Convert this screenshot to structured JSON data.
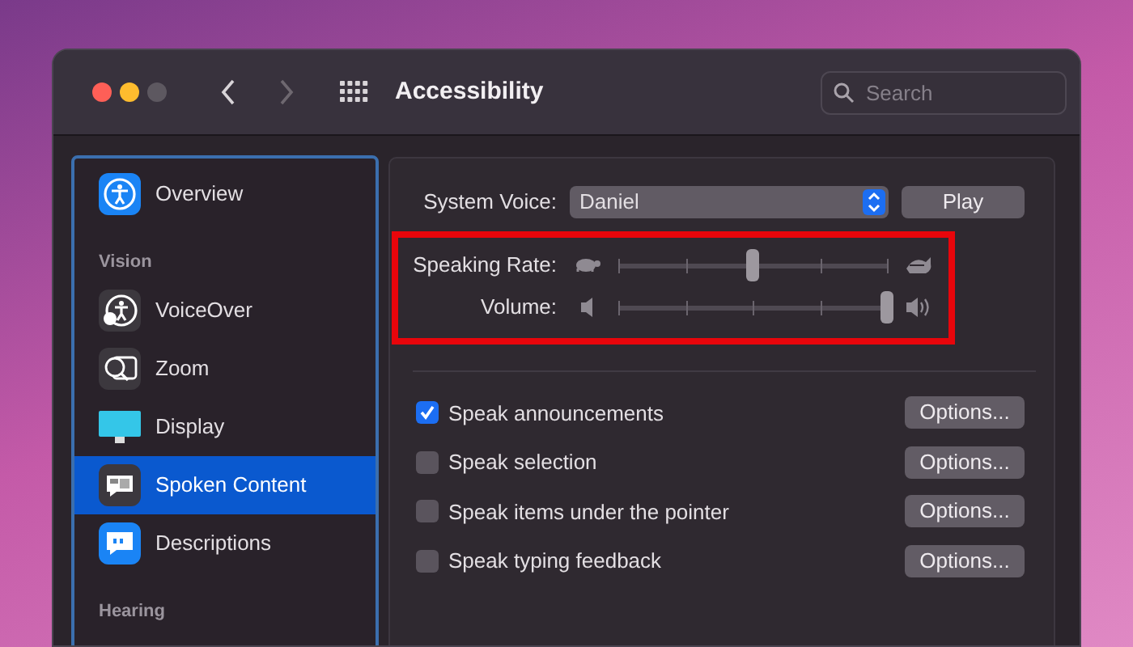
{
  "window": {
    "title": "Accessibility",
    "search": {
      "placeholder": "Search"
    }
  },
  "sidebar": {
    "items": [
      {
        "kind": "item",
        "label": "Overview",
        "selected": false
      },
      {
        "kind": "section",
        "label": "Vision"
      },
      {
        "kind": "item",
        "label": "VoiceOver",
        "selected": false
      },
      {
        "kind": "item",
        "label": "Zoom",
        "selected": false
      },
      {
        "kind": "item",
        "label": "Display",
        "selected": false
      },
      {
        "kind": "item",
        "label": "Spoken Content",
        "selected": true
      },
      {
        "kind": "item",
        "label": "Descriptions",
        "selected": false
      },
      {
        "kind": "section",
        "label": "Hearing"
      }
    ]
  },
  "voice": {
    "label": "System Voice:",
    "value": "Daniel",
    "play": "Play",
    "sliders_highlighted": true,
    "sliders": [
      {
        "label": "Speaking Rate:",
        "kind": "rate",
        "level": 0.5
      },
      {
        "label": "Volume:",
        "kind": "volume",
        "level": 1.0
      }
    ]
  },
  "options": [
    {
      "label": "Speak announcements",
      "checked": true,
      "button": "Options..."
    },
    {
      "label": "Speak selection",
      "checked": false,
      "button": "Options..."
    },
    {
      "label": "Speak items under the pointer",
      "checked": false,
      "button": "Options..."
    },
    {
      "label": "Speak typing feedback",
      "checked": false,
      "button": "Options..."
    }
  ]
}
